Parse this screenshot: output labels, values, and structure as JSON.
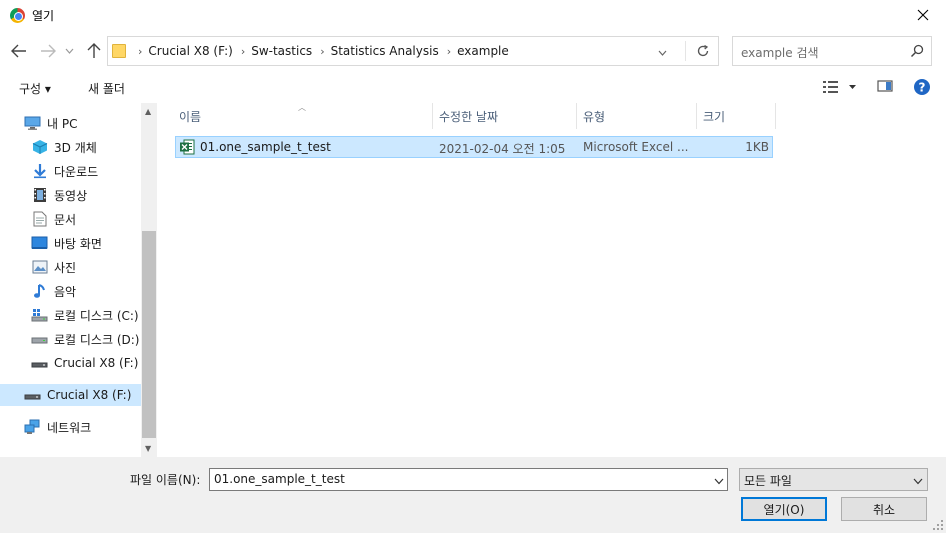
{
  "window": {
    "title": "열기"
  },
  "address": {
    "crumbs": [
      "Crucial X8 (F:)",
      "Sw-tastics",
      "Statistics Analysis",
      "example"
    ],
    "separator": "›"
  },
  "search": {
    "placeholder": "example 검색"
  },
  "toolbar": {
    "organize_label": "구성 ▾",
    "new_folder_label": "새 폴더"
  },
  "navpane": {
    "items": [
      {
        "label": "내 PC",
        "icon": "pc-icon"
      },
      {
        "label": "3D 개체",
        "icon": "3d-objects-icon"
      },
      {
        "label": "다운로드",
        "icon": "download-icon"
      },
      {
        "label": "동영상",
        "icon": "video-icon"
      },
      {
        "label": "문서",
        "icon": "document-icon"
      },
      {
        "label": "바탕 화면",
        "icon": "desktop-icon"
      },
      {
        "label": "사진",
        "icon": "picture-icon"
      },
      {
        "label": "음악",
        "icon": "music-icon"
      },
      {
        "label": "로컬 디스크 (C:)",
        "icon": "windows-drive-icon"
      },
      {
        "label": "로컬 디스크 (D:)",
        "icon": "drive-icon"
      },
      {
        "label": "Crucial X8 (F:)",
        "icon": "usb-drive-icon"
      },
      {
        "label": "Crucial X8 (F:)",
        "icon": "usb-drive-icon"
      },
      {
        "label": "네트워크",
        "icon": "network-icon"
      }
    ]
  },
  "filelist": {
    "columns": [
      "이름",
      "수정한 날짜",
      "유형",
      "크기"
    ],
    "rows": [
      {
        "name": "01.one_sample_t_test",
        "modified": "2021-02-04 오전 1:05",
        "type": "Microsoft Excel ...",
        "size": "1KB"
      }
    ]
  },
  "footer": {
    "filename_label": "파일 이름(N):",
    "filename_value": "01.one_sample_t_test",
    "filetype_value": "모든 파일",
    "open_label": "열기(O)",
    "cancel_label": "취소"
  },
  "colors": {
    "selection": "#cce8ff",
    "selection_border": "#99d1ff",
    "accent": "#0078d7",
    "excel": "#1d6f42"
  }
}
